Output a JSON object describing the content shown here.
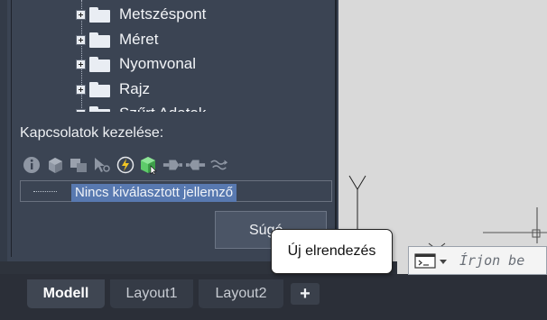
{
  "tree": {
    "items": [
      {
        "label": "Metszéspont"
      },
      {
        "label": "Méret"
      },
      {
        "label": "Nyomvonal"
      },
      {
        "label": "Rajz"
      },
      {
        "label": "Szűrt Adatok"
      }
    ]
  },
  "relations": {
    "label": "Kapcsolatok kezelése:",
    "selected_text": "Nincs kiválasztott jellemző",
    "toolbar_icons": [
      "info-icon",
      "cube-gray-icon",
      "cubes-gray-icon",
      "select-arrow-icon",
      "lightning-icon",
      "green-cube-icon",
      "connector-left-icon",
      "connector-right-icon",
      "wave-link-icon"
    ]
  },
  "button": {
    "label": "Súgó"
  },
  "command": {
    "placeholder": "Írjon be"
  },
  "tabs": {
    "items": [
      {
        "label": "Modell",
        "active": true
      },
      {
        "label": "Layout1",
        "active": false
      },
      {
        "label": "Layout2",
        "active": false
      }
    ],
    "add_label": "+"
  },
  "tooltip": {
    "text": "Új elrendezés"
  },
  "colors": {
    "panel": "#3b4453",
    "selection": "#5879b0",
    "accent_green": "#5ecb6a",
    "canvas": "#d9d9d9"
  }
}
